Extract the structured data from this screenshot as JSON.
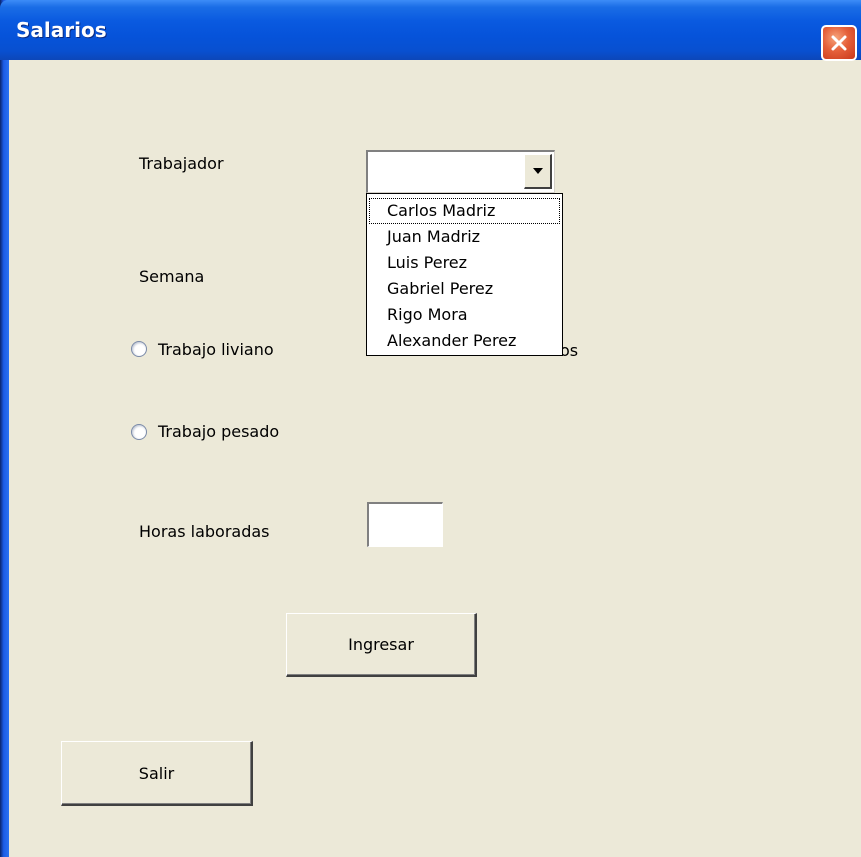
{
  "window": {
    "title": "Salarios"
  },
  "form": {
    "trabajador_label": "Trabajador",
    "semana_label": "Semana",
    "trabajo_liviano_label": "Trabajo liviano",
    "trabajo_pesado_label": "Trabajo pesado",
    "hidden_label_fragment": "os",
    "horas_label": "Horas laboradas",
    "horas_value": "",
    "trabajador_value": ""
  },
  "dropdown": {
    "items": [
      {
        "label": "Carlos Madriz"
      },
      {
        "label": "Juan Madriz"
      },
      {
        "label": "Luis Perez"
      },
      {
        "label": "Gabriel Perez"
      },
      {
        "label": "Rigo Mora"
      },
      {
        "label": "Alexander Perez"
      }
    ]
  },
  "buttons": {
    "ingresar": "Ingresar",
    "salir": "Salir"
  },
  "icons": {
    "close": "close-icon",
    "dropdown_arrow": "chevron-down-icon"
  },
  "colors": {
    "form_background": "#ece9d8",
    "titlebar_blue": "#0653da",
    "close_red": "#e5603a"
  }
}
